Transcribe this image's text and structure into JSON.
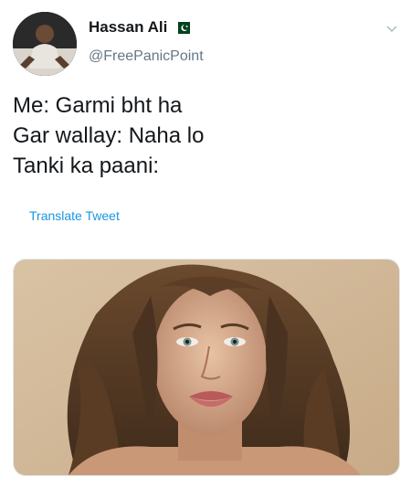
{
  "author": {
    "name": "Hassan Ali",
    "handle": "@FreePanicPoint",
    "flag_icon": "pakistan-flag-icon"
  },
  "tweet": {
    "lines": [
      "Me: Garmi bht ha",
      "Gar wallay: Naha lo",
      "Tanki ka paani:"
    ],
    "translate_label": "Translate Tweet"
  },
  "media": {
    "alt": "photo-of-woman-with-messy-hair"
  },
  "colors": {
    "text": "#14171a",
    "secondary": "#657786",
    "link": "#1b95e0",
    "flag_green": "#01411c"
  },
  "icons": {
    "more": "chevron-down-icon"
  }
}
